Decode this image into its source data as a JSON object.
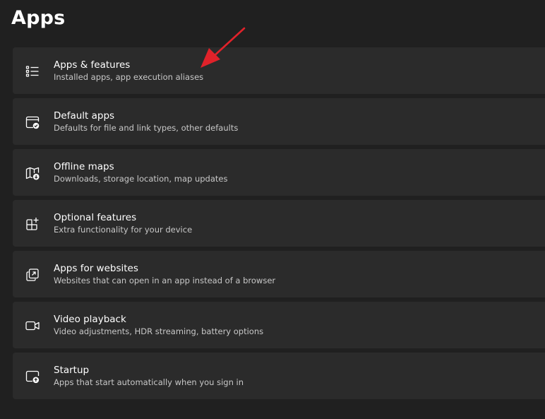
{
  "page": {
    "title": "Apps"
  },
  "items": [
    {
      "id": "apps-features",
      "title": "Apps & features",
      "subtitle": "Installed apps, app execution aliases",
      "icon": "list-icon"
    },
    {
      "id": "default-apps",
      "title": "Default apps",
      "subtitle": "Defaults for file and link types, other defaults",
      "icon": "default-apps-icon"
    },
    {
      "id": "offline-maps",
      "title": "Offline maps",
      "subtitle": "Downloads, storage location, map updates",
      "icon": "map-download-icon"
    },
    {
      "id": "optional-features",
      "title": "Optional features",
      "subtitle": "Extra functionality for your device",
      "icon": "add-grid-icon"
    },
    {
      "id": "apps-for-websites",
      "title": "Apps for websites",
      "subtitle": "Websites that can open in an app instead of a browser",
      "icon": "open-in-app-icon"
    },
    {
      "id": "video-playback",
      "title": "Video playback",
      "subtitle": "Video adjustments, HDR streaming, battery options",
      "icon": "video-camera-icon"
    },
    {
      "id": "startup",
      "title": "Startup",
      "subtitle": "Apps that start automatically when you sign in",
      "icon": "startup-icon"
    }
  ],
  "colors": {
    "background": "#202020",
    "card": "#2b2b2b",
    "arrow": "#e0222a"
  }
}
